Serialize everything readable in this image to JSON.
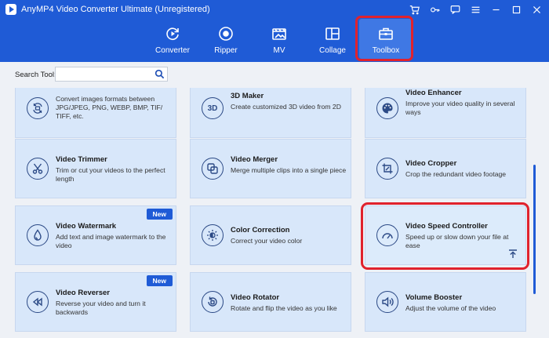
{
  "app": {
    "title": "AnyMP4 Video Converter Ultimate (Unregistered)"
  },
  "window_controls": [
    "cart-icon",
    "key-icon",
    "chat-icon",
    "menu-icon",
    "minimize-icon",
    "maximize-icon",
    "close-icon"
  ],
  "nav": {
    "tabs": [
      {
        "label": "Converter",
        "icon": "converter-icon"
      },
      {
        "label": "Ripper",
        "icon": "ripper-icon"
      },
      {
        "label": "MV",
        "icon": "mv-icon"
      },
      {
        "label": "Collage",
        "icon": "collage-icon"
      },
      {
        "label": "Toolbox",
        "icon": "toolbox-icon",
        "active": true
      }
    ]
  },
  "search": {
    "label": "Search Tool:",
    "value": "",
    "placeholder": ""
  },
  "tools": [
    {
      "title": "",
      "desc": "Convert images formats between JPG/JPEG, PNG, WEBP, BMP, TIF/ TIFF, etc.",
      "icon": "image-convert-icon"
    },
    {
      "title": "3D Maker",
      "desc": "Create customized 3D video from 2D",
      "icon": "3d-icon"
    },
    {
      "title": "Video Enhancer",
      "desc": "Improve your video quality in several ways",
      "icon": "palette-icon"
    },
    {
      "title": "Video Trimmer",
      "desc": "Trim or cut your videos to the perfect length",
      "icon": "scissors-icon"
    },
    {
      "title": "Video Merger",
      "desc": "Merge multiple clips into a single piece",
      "icon": "merge-icon"
    },
    {
      "title": "Video Cropper",
      "desc": "Crop the redundant video footage",
      "icon": "crop-icon"
    },
    {
      "title": "Video Watermark",
      "desc": "Add text and image watermark to the video",
      "icon": "watermark-icon",
      "badge": "New"
    },
    {
      "title": "Color Correction",
      "desc": "Correct your video color",
      "icon": "color-icon"
    },
    {
      "title": "Video Speed Controller",
      "desc": "Speed up or slow down your file at ease",
      "icon": "speedometer-icon",
      "selected": true
    },
    {
      "title": "Video Reverser",
      "desc": "Reverse your video and turn it backwards",
      "icon": "rewind-icon",
      "badge": "New"
    },
    {
      "title": "Video Rotator",
      "desc": "Rotate and flip the video as you like",
      "icon": "rotate-icon"
    },
    {
      "title": "Volume Booster",
      "desc": "Adjust the volume of the video",
      "icon": "volume-icon"
    }
  ],
  "colors": {
    "header": "#1f5bd6",
    "card": "#d8e7fa",
    "highlight": "#e0222d"
  }
}
